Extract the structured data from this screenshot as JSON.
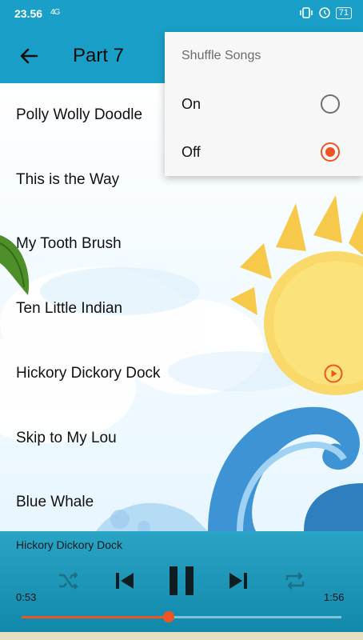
{
  "status_bar": {
    "time": "23.56",
    "signal": "4G",
    "battery": "71"
  },
  "app_bar": {
    "title": "Part 7"
  },
  "songs": [
    {
      "title": "Polly Wolly Doodle",
      "playing": false
    },
    {
      "title": "This is the Way",
      "playing": false
    },
    {
      "title": "My Tooth Brush",
      "playing": false
    },
    {
      "title": "Ten Little Indian",
      "playing": false
    },
    {
      "title": "Hickory Dickory Dock",
      "playing": true
    },
    {
      "title": "Skip to My Lou",
      "playing": false
    },
    {
      "title": "Blue Whale",
      "playing": false
    }
  ],
  "shuffle_menu": {
    "title": "Shuffle Songs",
    "options": [
      {
        "label": "On",
        "selected": false
      },
      {
        "label": "Off",
        "selected": true
      }
    ]
  },
  "player": {
    "now_playing": "Hickory Dickory Dock",
    "elapsed": "0:53",
    "duration": "1:56",
    "progress": 0.46
  },
  "colors": {
    "accent": "#f05423",
    "primary": "#1aa0c8"
  },
  "icons": [
    "back-arrow-icon",
    "play-circle-icon",
    "shuffle-icon",
    "previous-icon",
    "pause-icon",
    "next-icon",
    "repeat-icon"
  ]
}
